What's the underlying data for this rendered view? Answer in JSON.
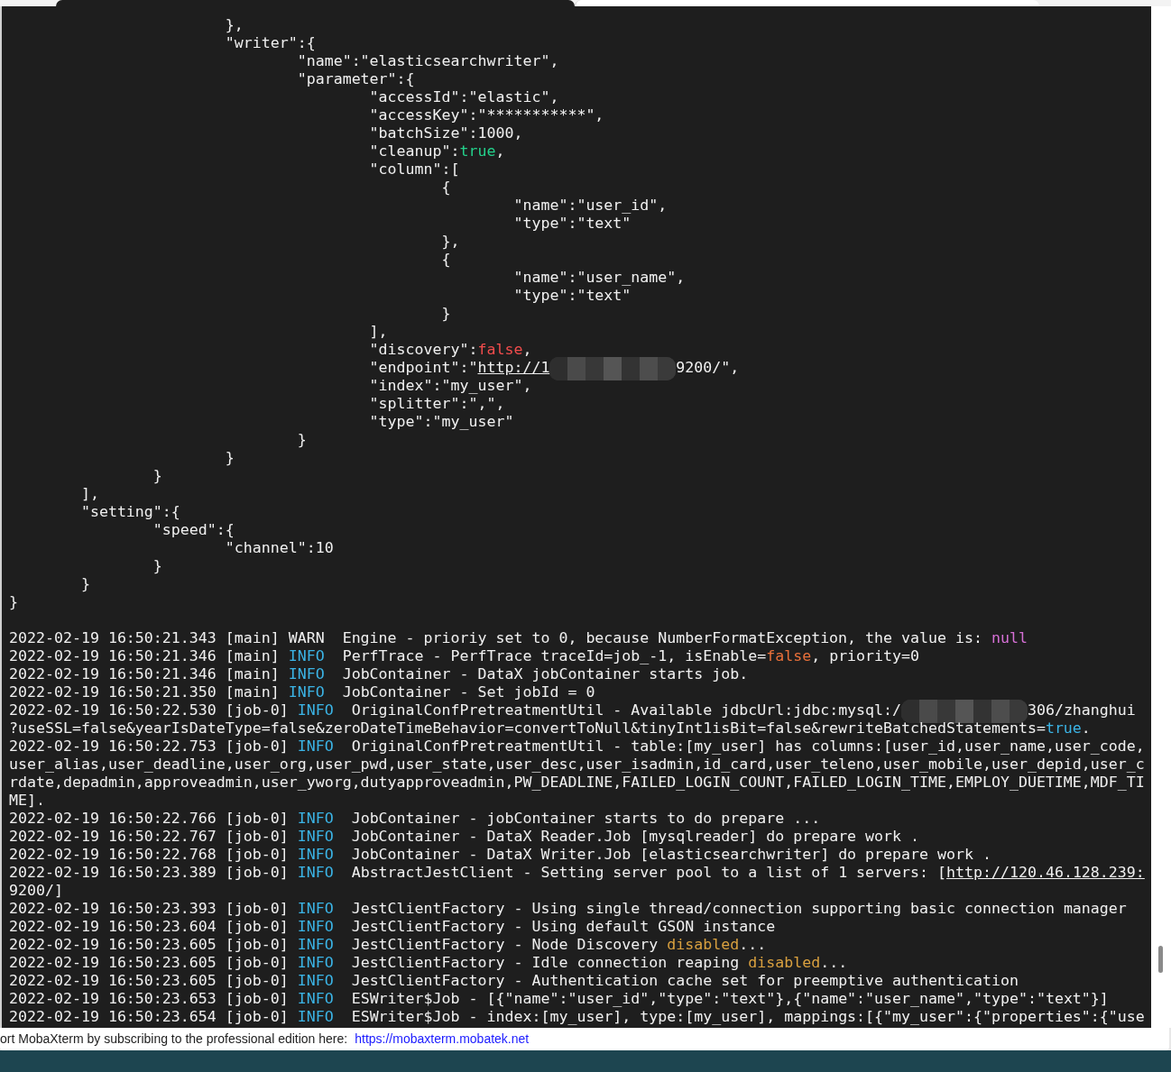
{
  "terminal": {
    "lines": [
      {
        "kind": "text",
        "segments": [
          {
            "kind": "plain",
            "text": "                        },"
          }
        ]
      },
      {
        "kind": "text",
        "segments": [
          {
            "kind": "plain",
            "text": "                        \"writer\":{"
          }
        ]
      },
      {
        "kind": "text",
        "segments": [
          {
            "kind": "plain",
            "text": "                                \"name\":\"elasticsearchwriter\","
          }
        ]
      },
      {
        "kind": "text",
        "segments": [
          {
            "kind": "plain",
            "text": "                                \"parameter\":{"
          }
        ]
      },
      {
        "kind": "text",
        "segments": [
          {
            "kind": "plain",
            "text": "                                        \"accessId\":\"elastic\","
          }
        ]
      },
      {
        "kind": "text",
        "segments": [
          {
            "kind": "plain",
            "text": "                                        \"accessKey\":\"***********\","
          }
        ]
      },
      {
        "kind": "text",
        "segments": [
          {
            "kind": "plain",
            "text": "                                        \"batchSize\":1000,"
          }
        ]
      },
      {
        "kind": "text",
        "segments": [
          {
            "kind": "plain",
            "text": "                                        \"cleanup\":"
          },
          {
            "kind": "green",
            "text": "true"
          },
          {
            "kind": "plain",
            "text": ","
          }
        ]
      },
      {
        "kind": "text",
        "segments": [
          {
            "kind": "plain",
            "text": "                                        \"column\":["
          }
        ]
      },
      {
        "kind": "text",
        "segments": [
          {
            "kind": "plain",
            "text": "                                                {"
          }
        ]
      },
      {
        "kind": "text",
        "segments": [
          {
            "kind": "plain",
            "text": "                                                        \"name\":\"user_id\","
          }
        ]
      },
      {
        "kind": "text",
        "segments": [
          {
            "kind": "plain",
            "text": "                                                        \"type\":\"text\""
          }
        ]
      },
      {
        "kind": "text",
        "segments": [
          {
            "kind": "plain",
            "text": "                                                },"
          }
        ]
      },
      {
        "kind": "text",
        "segments": [
          {
            "kind": "plain",
            "text": "                                                {"
          }
        ]
      },
      {
        "kind": "text",
        "segments": [
          {
            "kind": "plain",
            "text": "                                                        \"name\":\"user_name\","
          }
        ]
      },
      {
        "kind": "text",
        "segments": [
          {
            "kind": "plain",
            "text": "                                                        \"type\":\"text\""
          }
        ]
      },
      {
        "kind": "text",
        "segments": [
          {
            "kind": "plain",
            "text": "                                                }"
          }
        ]
      },
      {
        "kind": "text",
        "segments": [
          {
            "kind": "plain",
            "text": "                                        ],"
          }
        ]
      },
      {
        "kind": "text",
        "segments": [
          {
            "kind": "plain",
            "text": "                                        \"discovery\":"
          },
          {
            "kind": "red",
            "text": "false"
          },
          {
            "kind": "plain",
            "text": ","
          }
        ]
      },
      {
        "kind": "text",
        "segments": [
          {
            "kind": "plain",
            "text": "                                        \"endpoint\":\""
          },
          {
            "kind": "link",
            "text": "http://1"
          },
          {
            "kind": "redacted"
          },
          {
            "kind": "plain",
            "text": "9200/\","
          }
        ]
      },
      {
        "kind": "text",
        "segments": [
          {
            "kind": "plain",
            "text": "                                        \"index\":\"my_user\","
          }
        ]
      },
      {
        "kind": "text",
        "segments": [
          {
            "kind": "plain",
            "text": "                                        \"splitter\":\",\","
          }
        ]
      },
      {
        "kind": "text",
        "segments": [
          {
            "kind": "plain",
            "text": "                                        \"type\":\"my_user\""
          }
        ]
      },
      {
        "kind": "text",
        "segments": [
          {
            "kind": "plain",
            "text": "                                }"
          }
        ]
      },
      {
        "kind": "text",
        "segments": [
          {
            "kind": "plain",
            "text": "                        }"
          }
        ]
      },
      {
        "kind": "text",
        "segments": [
          {
            "kind": "plain",
            "text": "                }"
          }
        ]
      },
      {
        "kind": "text",
        "segments": [
          {
            "kind": "plain",
            "text": "        ],"
          }
        ]
      },
      {
        "kind": "text",
        "segments": [
          {
            "kind": "plain",
            "text": "        \"setting\":{"
          }
        ]
      },
      {
        "kind": "text",
        "segments": [
          {
            "kind": "plain",
            "text": "                \"speed\":{"
          }
        ]
      },
      {
        "kind": "text",
        "segments": [
          {
            "kind": "plain",
            "text": "                        \"channel\":10"
          }
        ]
      },
      {
        "kind": "text",
        "segments": [
          {
            "kind": "plain",
            "text": "                }"
          }
        ]
      },
      {
        "kind": "text",
        "segments": [
          {
            "kind": "plain",
            "text": "        }"
          }
        ]
      },
      {
        "kind": "text",
        "segments": [
          {
            "kind": "plain",
            "text": "}"
          }
        ]
      },
      {
        "kind": "blank"
      },
      {
        "kind": "text",
        "segments": [
          {
            "kind": "plain",
            "text": "2022-02-19 16:50:21.343 [main] WARN  Engine - prioriy set to 0, because NumberFormatException, the value is: "
          },
          {
            "kind": "magenta",
            "text": "null"
          }
        ]
      },
      {
        "kind": "text",
        "segments": [
          {
            "kind": "plain",
            "text": "2022-02-19 16:50:21.346 [main] "
          },
          {
            "kind": "info",
            "text": "INFO"
          },
          {
            "kind": "plain",
            "text": "  PerfTrace - PerfTrace traceId=job_-1, isEnable="
          },
          {
            "kind": "orange",
            "text": "false"
          },
          {
            "kind": "plain",
            "text": ", priority=0"
          }
        ]
      },
      {
        "kind": "text",
        "segments": [
          {
            "kind": "plain",
            "text": "2022-02-19 16:50:21.346 [main] "
          },
          {
            "kind": "info",
            "text": "INFO"
          },
          {
            "kind": "plain",
            "text": "  JobContainer - DataX jobContainer starts job."
          }
        ]
      },
      {
        "kind": "text",
        "segments": [
          {
            "kind": "plain",
            "text": "2022-02-19 16:50:21.350 [main] "
          },
          {
            "kind": "info",
            "text": "INFO"
          },
          {
            "kind": "plain",
            "text": "  JobContainer - Set jobId = 0"
          }
        ]
      },
      {
        "kind": "text",
        "segments": [
          {
            "kind": "plain",
            "text": "2022-02-19 16:50:22.530 [job-0] "
          },
          {
            "kind": "info",
            "text": "INFO"
          },
          {
            "kind": "plain",
            "text": "  OriginalConfPretreatmentUtil - Available jdbcUrl:jdbc:mysql:/"
          },
          {
            "kind": "redacted"
          },
          {
            "kind": "plain",
            "text": "306/zhanghui"
          }
        ]
      },
      {
        "kind": "text",
        "segments": [
          {
            "kind": "plain",
            "text": "?useSSL=false&yearIsDateType=false&zeroDateTimeBehavior=convertToNull&tinyInt1isBit=false&rewriteBatchedStatements="
          },
          {
            "kind": "info",
            "text": "true"
          },
          {
            "kind": "plain",
            "text": "."
          }
        ]
      },
      {
        "kind": "text",
        "segments": [
          {
            "kind": "plain",
            "text": "2022-02-19 16:50:22.753 [job-0] "
          },
          {
            "kind": "info",
            "text": "INFO"
          },
          {
            "kind": "plain",
            "text": "  OriginalConfPretreatmentUtil - table:[my_user] has columns:[user_id,user_name,user_code,"
          }
        ]
      },
      {
        "kind": "text",
        "segments": [
          {
            "kind": "plain",
            "text": "user_alias,user_deadline,user_org,user_pwd,user_state,user_desc,user_isadmin,id_card,user_teleno,user_mobile,user_depid,user_c"
          }
        ]
      },
      {
        "kind": "text",
        "segments": [
          {
            "kind": "plain",
            "text": "rdate,depadmin,approveadmin,user_yworg,dutyapproveadmin,PW_DEADLINE,FAILED_LOGIN_COUNT,FAILED_LOGIN_TIME,EMPLOY_DUETIME,MDF_TI"
          }
        ]
      },
      {
        "kind": "text",
        "segments": [
          {
            "kind": "plain",
            "text": "ME]."
          }
        ]
      },
      {
        "kind": "text",
        "segments": [
          {
            "kind": "plain",
            "text": "2022-02-19 16:50:22.766 [job-0] "
          },
          {
            "kind": "info",
            "text": "INFO"
          },
          {
            "kind": "plain",
            "text": "  JobContainer - jobContainer starts to do prepare ..."
          }
        ]
      },
      {
        "kind": "text",
        "segments": [
          {
            "kind": "plain",
            "text": "2022-02-19 16:50:22.767 [job-0] "
          },
          {
            "kind": "info",
            "text": "INFO"
          },
          {
            "kind": "plain",
            "text": "  JobContainer - DataX Reader.Job [mysqlreader] do prepare work ."
          }
        ]
      },
      {
        "kind": "text",
        "segments": [
          {
            "kind": "plain",
            "text": "2022-02-19 16:50:22.768 [job-0] "
          },
          {
            "kind": "info",
            "text": "INFO"
          },
          {
            "kind": "plain",
            "text": "  JobContainer - DataX Writer.Job [elasticsearchwriter] do prepare work ."
          }
        ]
      },
      {
        "kind": "text",
        "segments": [
          {
            "kind": "plain",
            "text": "2022-02-19 16:50:23.389 [job-0] "
          },
          {
            "kind": "info",
            "text": "INFO"
          },
          {
            "kind": "plain",
            "text": "  AbstractJestClient - Setting server pool to a list of 1 servers: ["
          },
          {
            "kind": "link",
            "text": "http://120.46.128.239:"
          }
        ]
      },
      {
        "kind": "text",
        "segments": [
          {
            "kind": "plain",
            "text": "9200/]"
          }
        ]
      },
      {
        "kind": "text",
        "segments": [
          {
            "kind": "plain",
            "text": "2022-02-19 16:50:23.393 [job-0] "
          },
          {
            "kind": "info",
            "text": "INFO"
          },
          {
            "kind": "plain",
            "text": "  JestClientFactory - Using single thread/connection supporting basic connection manager"
          }
        ]
      },
      {
        "kind": "text",
        "segments": [
          {
            "kind": "plain",
            "text": "2022-02-19 16:50:23.604 [job-0] "
          },
          {
            "kind": "info",
            "text": "INFO"
          },
          {
            "kind": "plain",
            "text": "  JestClientFactory - Using default GSON instance"
          }
        ]
      },
      {
        "kind": "text",
        "segments": [
          {
            "kind": "plain",
            "text": "2022-02-19 16:50:23.605 [job-0] "
          },
          {
            "kind": "info",
            "text": "INFO"
          },
          {
            "kind": "plain",
            "text": "  JestClientFactory - Node Discovery "
          },
          {
            "kind": "yellow",
            "text": "disabled"
          },
          {
            "kind": "plain",
            "text": "..."
          }
        ]
      },
      {
        "kind": "text",
        "segments": [
          {
            "kind": "plain",
            "text": "2022-02-19 16:50:23.605 [job-0] "
          },
          {
            "kind": "info",
            "text": "INFO"
          },
          {
            "kind": "plain",
            "text": "  JestClientFactory - Idle connection reaping "
          },
          {
            "kind": "yellow",
            "text": "disabled"
          },
          {
            "kind": "plain",
            "text": "..."
          }
        ]
      },
      {
        "kind": "text",
        "segments": [
          {
            "kind": "plain",
            "text": "2022-02-19 16:50:23.605 [job-0] "
          },
          {
            "kind": "info",
            "text": "INFO"
          },
          {
            "kind": "plain",
            "text": "  JestClientFactory - Authentication cache set for preemptive authentication"
          }
        ]
      },
      {
        "kind": "text",
        "segments": [
          {
            "kind": "plain",
            "text": "2022-02-19 16:50:23.653 [job-0] "
          },
          {
            "kind": "info",
            "text": "INFO"
          },
          {
            "kind": "plain",
            "text": "  ESWriter$Job - [{\"name\":\"user_id\",\"type\":\"text\"},{\"name\":\"user_name\",\"type\":\"text\"}]"
          }
        ]
      },
      {
        "kind": "text",
        "segments": [
          {
            "kind": "plain",
            "text": "2022-02-19 16:50:23.654 [job-0] "
          },
          {
            "kind": "info",
            "text": "INFO"
          },
          {
            "kind": "plain",
            "text": "  ESWriter$Job - index:[my_user], type:[my_user], mappings:[{\"my_user\":{\"properties\":{\"use"
          }
        ]
      }
    ]
  },
  "status_bar": {
    "text": "ort MobaXterm by subscribing to the professional edition here:",
    "link": "https://mobaxterm.mobatek.net"
  }
}
